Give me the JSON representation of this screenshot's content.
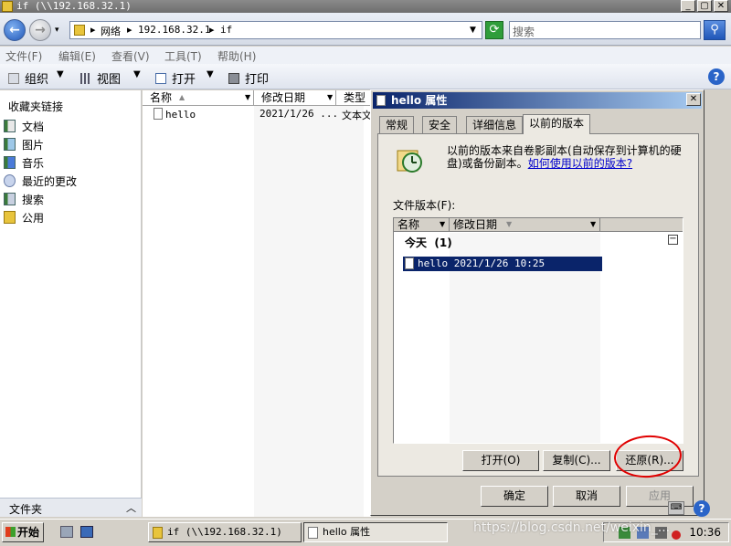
{
  "explorer": {
    "title": "if (\\\\192.168.32.1)",
    "address": {
      "crumbs": [
        "网络",
        "192.168.32.1",
        "if"
      ]
    },
    "search": {
      "placeholder": "搜索"
    },
    "menu": [
      "文件(F)",
      "编辑(E)",
      "查看(V)",
      "工具(T)",
      "帮助(H)"
    ],
    "toolbar": {
      "organize": "组织",
      "views": "视图",
      "open": "打开",
      "print": "打印"
    },
    "nav": {
      "header": "收藏夹链接",
      "items": [
        "文档",
        "图片",
        "音乐",
        "最近的更改",
        "搜索",
        "公用"
      ],
      "folders_label": "文件夹"
    },
    "filelist": {
      "columns": [
        "名称",
        "修改日期",
        "类型"
      ],
      "rows": [
        {
          "name": "hello",
          "date": "2021/1/26 ...",
          "type": "文本文"
        }
      ]
    }
  },
  "dialog": {
    "title": "hello 属性",
    "tabs": [
      "常规",
      "安全",
      "详细信息",
      "以前的版本"
    ],
    "active_tab": "以前的版本",
    "description": "以前的版本来自卷影副本(自动保存到计算机的硬盘)或备份副本。",
    "link": "如何使用以前的版本?",
    "file_versions_label": "文件版本(F):",
    "list_columns": [
      "名称",
      "修改日期"
    ],
    "group": {
      "label": "今天",
      "count": "(1)"
    },
    "version_row": "hello  2021/1/26 10:25",
    "buttons": {
      "open": "打开(O)",
      "copy": "复制(C)...",
      "restore": "还原(R)...",
      "ok": "确定",
      "cancel": "取消",
      "apply": "应用"
    }
  },
  "taskbar": {
    "start": "开始",
    "tasks": [
      "if (\\\\192.168.32.1)",
      "hello 属性"
    ],
    "clock": "10:36"
  },
  "watermark": "https://blog.csdn.net/weixin_..."
}
